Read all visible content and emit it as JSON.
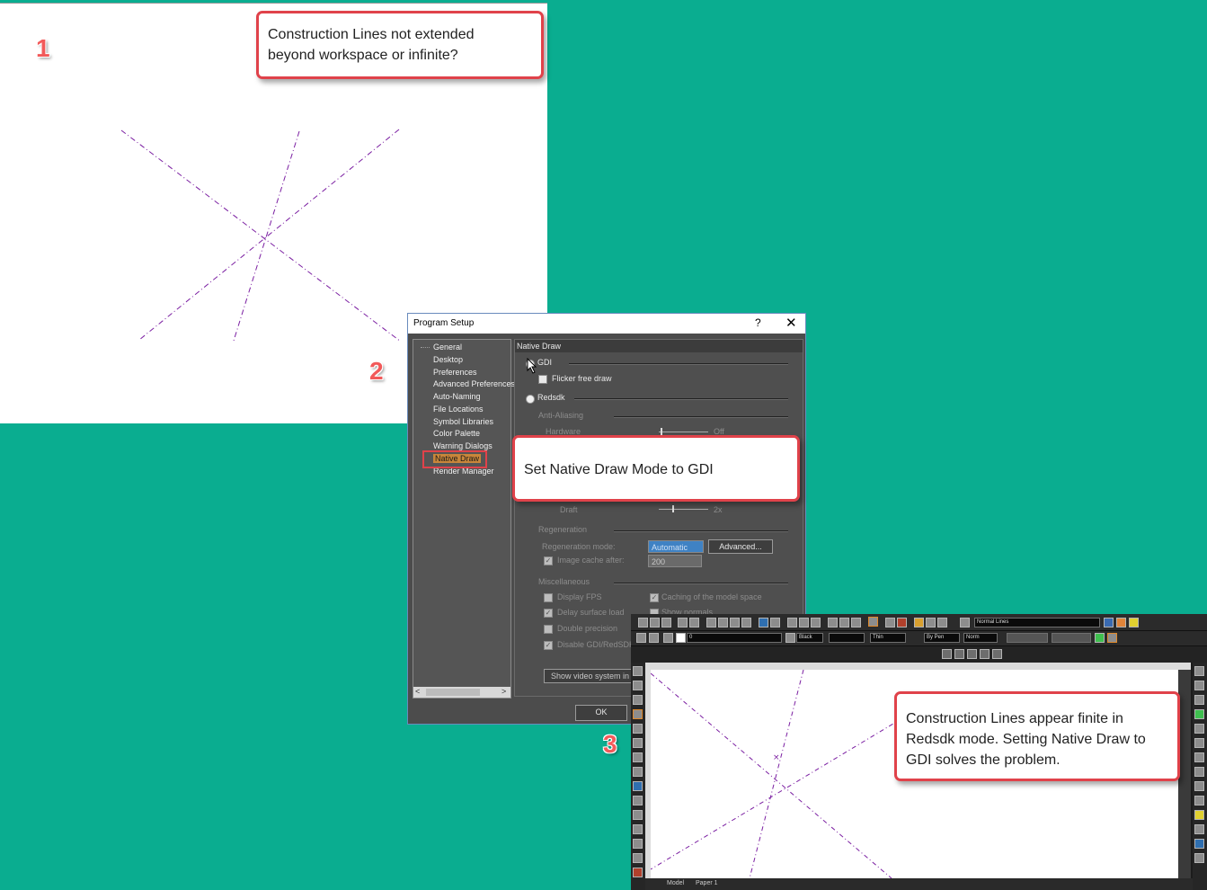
{
  "steps": [
    "1",
    "2",
    "3"
  ],
  "callouts": {
    "c1": {
      "line1": "Construction Lines not extended",
      "line2": "beyond workspace or infinite?"
    },
    "c2": {
      "text": "Set Native Draw Mode to GDI"
    },
    "c3": {
      "line1": "Construction Lines appear finite in",
      "line2": "Redsdk mode. Setting Native Draw to",
      "line3": "GDI solves the problem."
    }
  },
  "dialog": {
    "title": "Program Setup",
    "help": "?",
    "close": "✕",
    "tree": [
      "General",
      "Desktop",
      "Preferences",
      "Advanced Preferences",
      "Auto-Naming",
      "File Locations",
      "Symbol Libraries",
      "Color Palette",
      "Warning Dialogs",
      "Native Draw",
      "Render Manager"
    ],
    "tree_scroll_left": "<",
    "tree_scroll_right": ">",
    "section": "Native Draw",
    "gdi": "GDI",
    "flicker": "Flicker free draw",
    "redsdk": "Redsdk",
    "anti_aliasing": "Anti-Aliasing",
    "hardware": "Hardware",
    "off": "Off",
    "draft": "Draft",
    "two_x": "2x",
    "regeneration": "Regeneration",
    "regen_mode": "Regeneration mode:",
    "regen_value": "Automatic",
    "advanced": "Advanced...",
    "image_cache": "Image cache after:",
    "image_cache_value": "200",
    "misc": "Miscellaneous",
    "display_fps": "Display FPS",
    "caching": "Caching of the model space",
    "delay_surface": "Delay surface load",
    "show_normals": "Show normals",
    "double_precision": "Double precision",
    "disable_gdi": "Disable GDI/RedSDK",
    "show_video": "Show video system in",
    "ok": "OK"
  },
  "app": {
    "layer_field": "0",
    "color_field": "Black",
    "linetype_field": "Thin",
    "linescale_field": "By Pen",
    "style_field": "Norm",
    "style_menu": "Normal Lines",
    "tab_model": "Model",
    "tab_paper": "Paper 1"
  },
  "colors": {
    "background": "#0aad90",
    "callout_border": "#e0424a",
    "construction_line": "#7b1fa2"
  }
}
